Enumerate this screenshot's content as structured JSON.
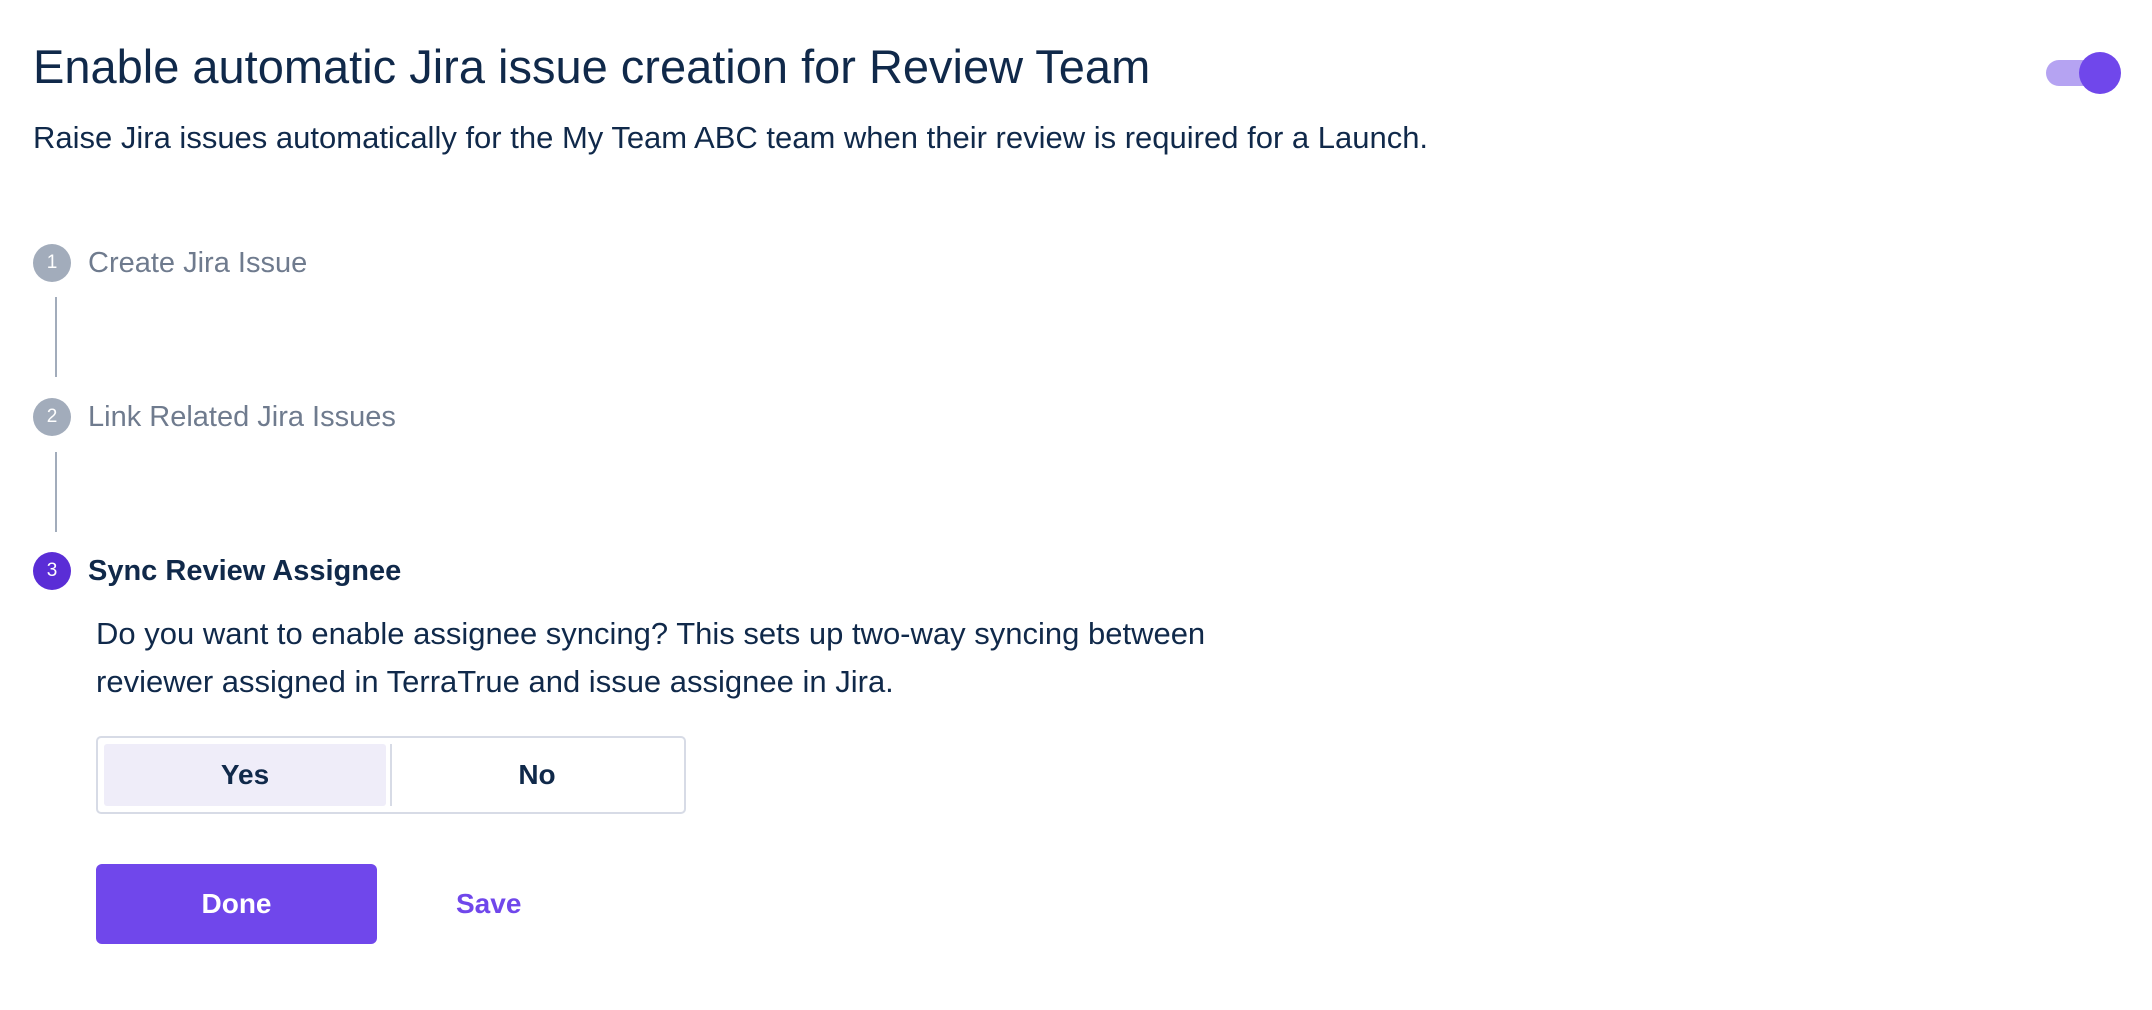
{
  "header": {
    "title": "Enable automatic Jira issue creation for Review Team",
    "subtitle": "Raise Jira issues automatically for the My Team ABC team when their review is required for a Launch.",
    "toggle_enabled": true
  },
  "steps": [
    {
      "number": "1",
      "label": "Create Jira Issue",
      "active": false
    },
    {
      "number": "2",
      "label": "Link Related Jira Issues",
      "active": false
    },
    {
      "number": "3",
      "label": "Sync Review Assignee",
      "active": true
    }
  ],
  "sync_step": {
    "question": "Do you want to enable assignee syncing? This sets up two-way syncing between reviewer assigned in TerraTrue and issue assignee in Jira.",
    "options": {
      "yes": "Yes",
      "no": "No"
    },
    "selected": "Yes"
  },
  "actions": {
    "done_label": "Done",
    "save_label": "Save"
  },
  "colors": {
    "primary": "#7047eb",
    "active_step": "#5a2dd6",
    "inactive_step": "#a2acbb",
    "text": "#10294a",
    "selected_option_bg": "#efedf9"
  }
}
